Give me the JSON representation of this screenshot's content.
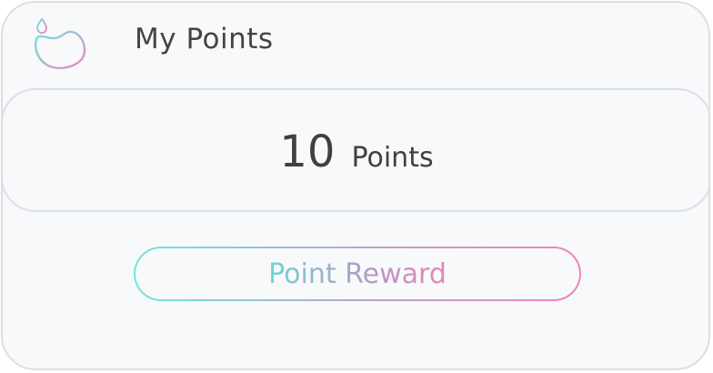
{
  "header": {
    "title": "My Points",
    "logo_icon": "droplet-logo-icon"
  },
  "points": {
    "value": "10",
    "unit": "Points"
  },
  "reward_button": {
    "label": "Point Reward"
  },
  "colors": {
    "card_background": "#f8f9fb",
    "border": "#dcdfe3",
    "text": "#444444",
    "gradient_start": "#6fe6e0",
    "gradient_mid": "#b6a7c8",
    "gradient_end": "#ef85ba"
  }
}
